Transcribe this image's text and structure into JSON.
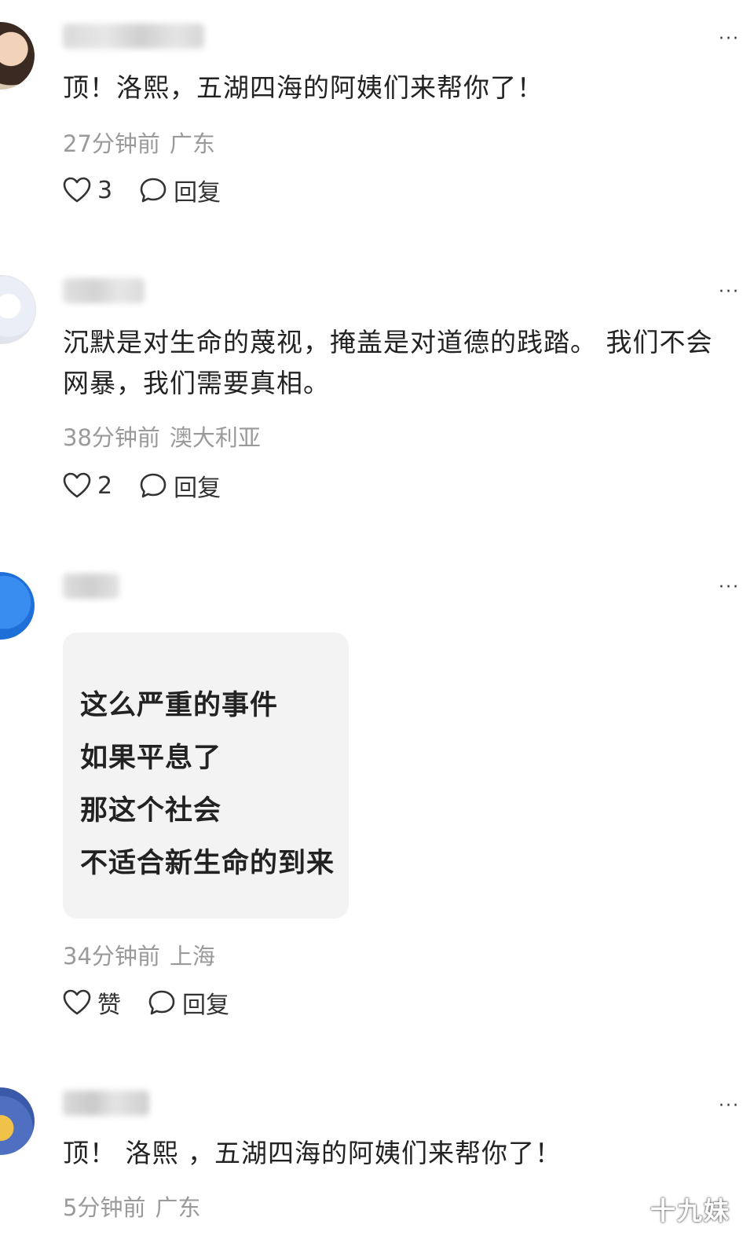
{
  "comments": [
    {
      "text": "顶！洛熙，五湖四海的阿姨们来帮你了！",
      "time": "27分钟前",
      "location": "广东",
      "like_label": "3",
      "reply_label": "回复",
      "more_label": "···"
    },
    {
      "text": "沉默是对生命的蔑视，掩盖是对道德的践踏。 我们不会网暴，我们需要真相。",
      "time": "38分钟前",
      "location": "澳大利亚",
      "like_label": "2",
      "reply_label": "回复",
      "more_label": "···"
    },
    {
      "image_lines": [
        "这么严重的事件",
        "如果平息了",
        "那这个社会",
        "不适合新生命的到来"
      ],
      "time": "34分钟前",
      "location": "上海",
      "like_label": "赞",
      "reply_label": "回复",
      "more_label": "···"
    },
    {
      "text": "顶！ 洛熙 ，五湖四海的阿姨们来帮你了！",
      "time": "5分钟前",
      "location": "广东",
      "more_label": "···"
    }
  ],
  "watermark": "十九妹",
  "colors": {
    "meta_text": "#9a9a9a",
    "body_text": "#222222",
    "image_card_bg": "#f3f3f3"
  },
  "icons": {
    "like": "heart-outline-icon",
    "reply": "speech-bubble-icon",
    "more": "more-dots-icon"
  }
}
